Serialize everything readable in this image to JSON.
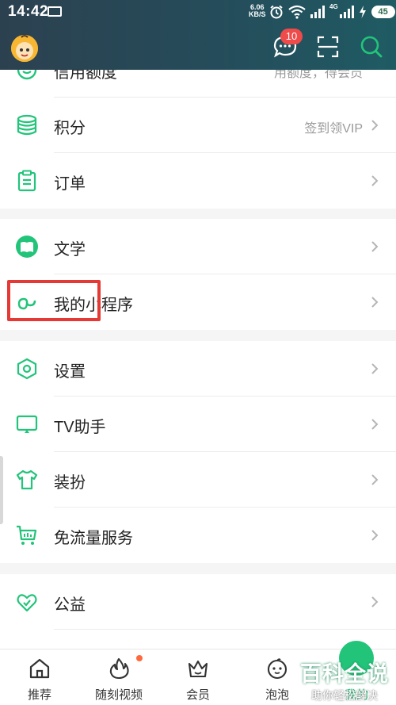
{
  "status": {
    "time": "14:42",
    "speed_value": "6.06",
    "speed_unit": "KB/S",
    "network": "4G",
    "battery": "45"
  },
  "header": {
    "badge_count": "10"
  },
  "menu": {
    "credit": {
      "label": "信用额度",
      "extra": "用额度，得会员"
    },
    "points": {
      "label": "积分",
      "extra": "签到领VIP"
    },
    "orders": {
      "label": "订单"
    },
    "literature": {
      "label": "文学"
    },
    "miniprograms": {
      "label": "我的小程序"
    },
    "settings": {
      "label": "设置"
    },
    "tv": {
      "label": "TV助手"
    },
    "dressup": {
      "label": "装扮"
    },
    "freeflow": {
      "label": "免流量服务"
    },
    "charity": {
      "label": "公益"
    }
  },
  "nav": {
    "home": "推荐",
    "video": "随刻视频",
    "vip": "会员",
    "bubble": "泡泡",
    "me": "我的"
  },
  "watermark": {
    "title": "百科全说",
    "subtitle": "助你轻松解决"
  },
  "colors": {
    "accent": "#22c47a",
    "badge": "#f04b4b",
    "highlight": "#e53935",
    "header": "#254c5a"
  }
}
